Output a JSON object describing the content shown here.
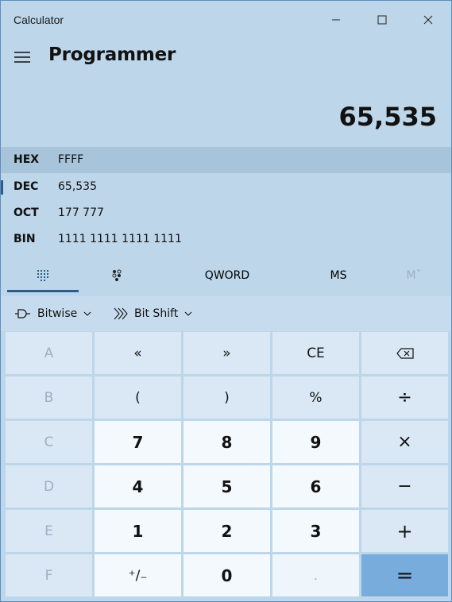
{
  "app": {
    "title": "Calculator"
  },
  "header": {
    "mode": "Programmer"
  },
  "display": {
    "value": "65,535"
  },
  "radix": [
    {
      "label": "HEX",
      "value": "FFFF",
      "selected": true
    },
    {
      "label": "DEC",
      "value": "65,535",
      "selected": false
    },
    {
      "label": "OCT",
      "value": "177 777",
      "selected": false
    },
    {
      "label": "BIN",
      "value": "1111 1111 1111 1111",
      "selected": false
    }
  ],
  "tabs": {
    "word_size": "QWORD",
    "memory_store": "MS",
    "memory_recall": "Mˇ"
  },
  "tools": {
    "bitwise": "Bitwise",
    "bitshift": "Bit Shift"
  },
  "keys": {
    "r1": [
      "A",
      "«",
      "»",
      "CE",
      ""
    ],
    "r2": [
      "B",
      "(",
      ")",
      "%",
      "÷"
    ],
    "r3": [
      "C",
      "7",
      "8",
      "9",
      "×"
    ],
    "r4": [
      "D",
      "4",
      "5",
      "6",
      "−"
    ],
    "r5": [
      "E",
      "1",
      "2",
      "3",
      "+"
    ],
    "r6": [
      "F",
      "⁺/₋",
      "0",
      ".",
      "="
    ]
  },
  "colors": {
    "background": "#bdd6ea",
    "equals": "#78acdc",
    "accent": "#2a5d8c"
  }
}
